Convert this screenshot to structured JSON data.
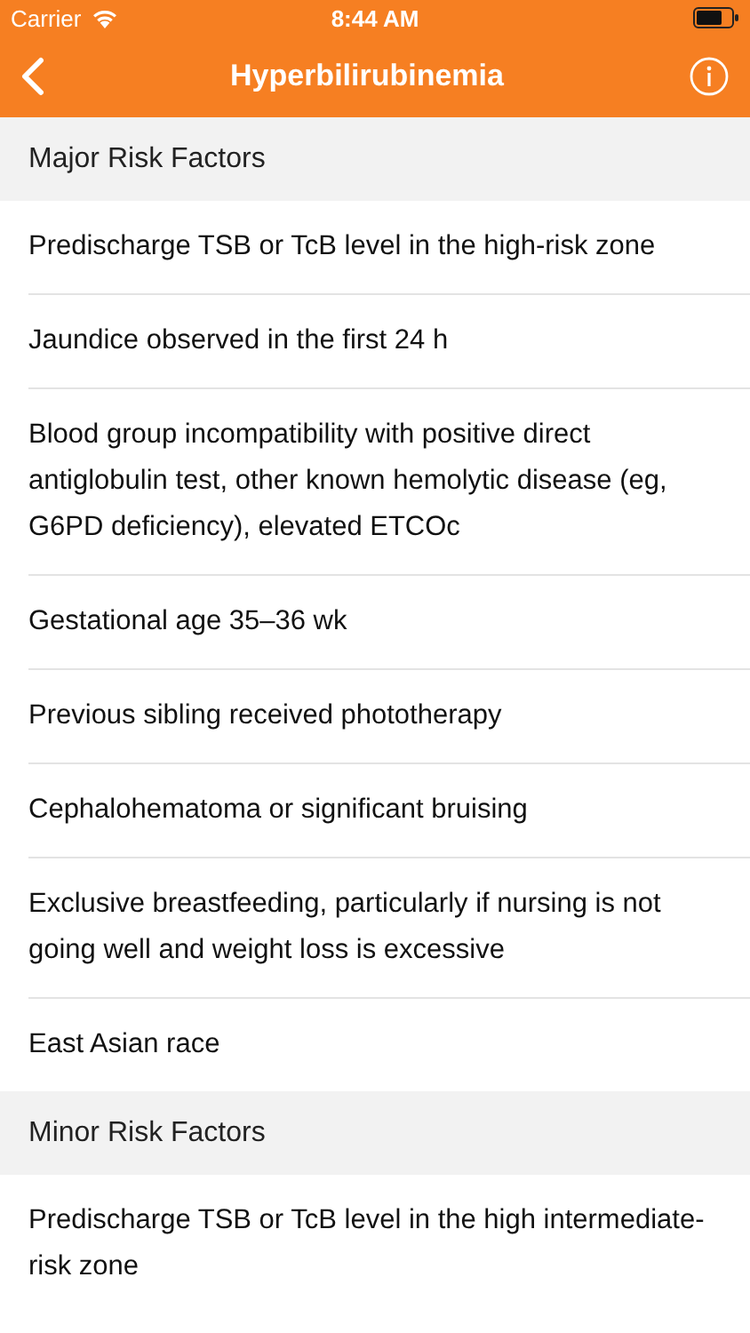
{
  "status_bar": {
    "carrier": "Carrier",
    "time": "8:44 AM"
  },
  "nav_bar": {
    "title": "Hyperbilirubinemia"
  },
  "sections": [
    {
      "title": "Major Risk Factors",
      "items": [
        "Predischarge TSB or TcB level in the high-risk zone",
        "Jaundice observed in the first 24 h",
        "Blood group incompatibility with positive direct antiglobulin test, other known hemolytic disease (eg, G6PD deficiency), elevated ETCOc",
        "Gestational age 35–36 wk",
        "Previous sibling received phototherapy",
        "Cephalohematoma or significant bruising",
        "Exclusive breastfeeding, particularly if nursing is not going well and weight loss is excessive",
        "East Asian race"
      ]
    },
    {
      "title": "Minor Risk Factors",
      "items": [
        "Predischarge TSB or TcB level in the high intermediate-risk zone"
      ]
    }
  ]
}
